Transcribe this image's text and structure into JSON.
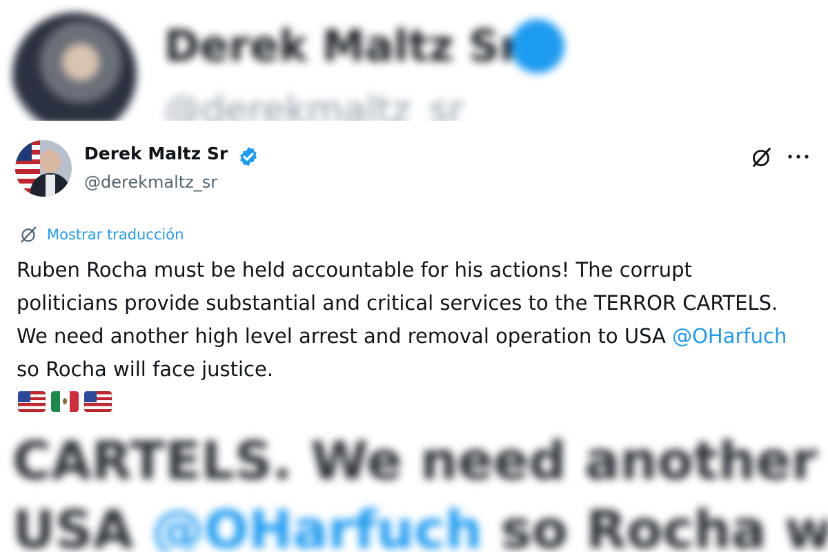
{
  "background": {
    "top_name": "Derek Maltz Sr",
    "top_handle": "@derekmaltz_sr",
    "bottom_line1": "CARTELS. We need another high",
    "bottom_line2_prefix": "USA ",
    "bottom_line2_mention": "@OHarfuch",
    "bottom_line2_suffix": " so Rocha will fa"
  },
  "tweet": {
    "author_name": "Derek Maltz Sr",
    "author_handle": "@derekmaltz_sr",
    "verified": true,
    "translate_label": "Mostrar traducción",
    "text_before_mention": "Ruben Rocha must be held accountable for his actions! The corrupt politicians provide substantial and critical services to the TERROR CARTELS. We need another high level arrest and removal operation to USA ",
    "mention": "@OHarfuch",
    "text_after_mention": " so Rocha will face justice.",
    "flags": [
      "us-flag-icon",
      "mexico-flag-icon",
      "us-flag-icon"
    ]
  },
  "colors": {
    "accent": "#1d9bf0",
    "text": "#0f1419",
    "secondary_text": "#536471"
  }
}
